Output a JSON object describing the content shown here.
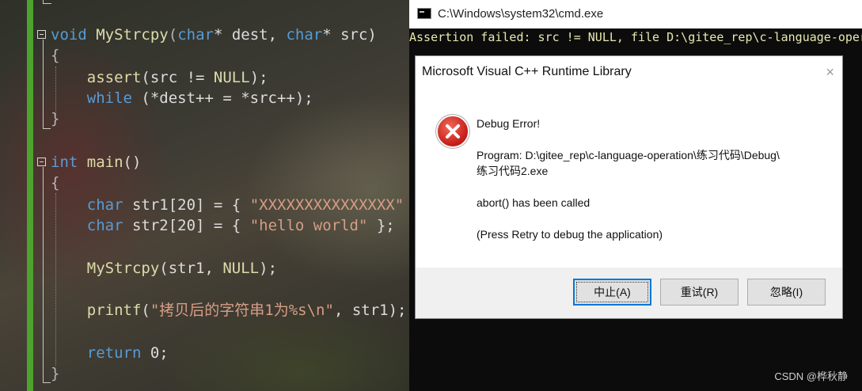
{
  "editor": {
    "lines": [
      {
        "tokens": [
          {
            "t": "void",
            "c": "kw"
          },
          {
            "t": " ",
            "c": "txt"
          },
          {
            "t": "MyStrcpy",
            "c": "fn"
          },
          {
            "t": "(",
            "c": "sym"
          },
          {
            "t": "char",
            "c": "kw"
          },
          {
            "t": "* dest, ",
            "c": "txt"
          },
          {
            "t": "char",
            "c": "kw"
          },
          {
            "t": "* src)",
            "c": "txt"
          }
        ]
      },
      {
        "tokens": [
          {
            "t": "{",
            "c": "sym"
          }
        ]
      },
      {
        "tokens": [
          {
            "t": "    ",
            "c": "txt"
          },
          {
            "t": "assert",
            "c": "fn"
          },
          {
            "t": "(src != ",
            "c": "txt"
          },
          {
            "t": "NULL",
            "c": "fn"
          },
          {
            "t": ");",
            "c": "txt"
          }
        ]
      },
      {
        "tokens": [
          {
            "t": "    ",
            "c": "txt"
          },
          {
            "t": "while",
            "c": "kw"
          },
          {
            "t": " (*dest++ = *src++);",
            "c": "txt"
          }
        ]
      },
      {
        "tokens": [
          {
            "t": "}",
            "c": "sym"
          }
        ]
      },
      {
        "tokens": [
          {
            "t": "int",
            "c": "kw"
          },
          {
            "t": " ",
            "c": "txt"
          },
          {
            "t": "main",
            "c": "fn"
          },
          {
            "t": "()",
            "c": "txt"
          }
        ]
      },
      {
        "tokens": [
          {
            "t": "{",
            "c": "sym"
          }
        ]
      },
      {
        "tokens": [
          {
            "t": "    ",
            "c": "txt"
          },
          {
            "t": "char",
            "c": "kw"
          },
          {
            "t": " str1[20] = { ",
            "c": "txt"
          },
          {
            "t": "\"XXXXXXXXXXXXXXX\"",
            "c": "str"
          },
          {
            "t": " };",
            "c": "txt"
          }
        ]
      },
      {
        "tokens": [
          {
            "t": "    ",
            "c": "txt"
          },
          {
            "t": "char",
            "c": "kw"
          },
          {
            "t": " str2[20] = { ",
            "c": "txt"
          },
          {
            "t": "\"hello world\"",
            "c": "str"
          },
          {
            "t": " };",
            "c": "txt"
          }
        ]
      },
      {
        "tokens": [
          {
            "t": "    ",
            "c": "txt"
          },
          {
            "t": "MyStrcpy",
            "c": "fn"
          },
          {
            "t": "(str1, ",
            "c": "txt"
          },
          {
            "t": "NULL",
            "c": "fn"
          },
          {
            "t": ");",
            "c": "txt"
          }
        ]
      },
      {
        "tokens": [
          {
            "t": "    ",
            "c": "txt"
          },
          {
            "t": "printf",
            "c": "fn"
          },
          {
            "t": "(",
            "c": "txt"
          },
          {
            "t": "\"拷贝后的字符串1为%s\\n\"",
            "c": "str"
          },
          {
            "t": ", str1);",
            "c": "txt"
          }
        ]
      },
      {
        "tokens": [
          {
            "t": "    ",
            "c": "txt"
          },
          {
            "t": "return",
            "c": "kw"
          },
          {
            "t": " 0;",
            "c": "txt"
          }
        ]
      },
      {
        "tokens": [
          {
            "t": "}",
            "c": "sym"
          }
        ]
      }
    ],
    "gutter_color": "#4ea22e"
  },
  "cmd": {
    "title": "C:\\Windows\\system32\\cmd.exe",
    "output": "Assertion failed: src != NULL, file D:\\gitee_rep\\c-language-oper"
  },
  "dialog": {
    "title": "Microsoft Visual C++ Runtime Library",
    "close_glyph": "×",
    "icon": "error-icon",
    "heading": "Debug Error!",
    "program_line1": "Program: D:\\gitee_rep\\c-language-operation\\练习代码\\Debug\\",
    "program_line2": "练习代码2.exe",
    "abort_msg": "abort() has been called",
    "hint": "(Press Retry to debug the application)",
    "buttons": {
      "abort": "中止(A)",
      "retry": "重试(R)",
      "ignore": "忽略(I)"
    }
  },
  "watermark": "CSDN @桦秋静"
}
